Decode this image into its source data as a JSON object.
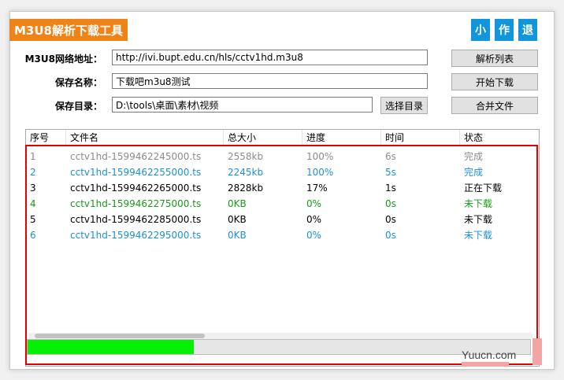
{
  "app": {
    "title": "M3U8解析下载工具"
  },
  "top_buttons": {
    "minimize": "小",
    "author": "作",
    "exit": "退"
  },
  "form": {
    "url_label": "M3U8网络地址：",
    "url_value": "http://ivi.bupt.edu.cn/hls/cctv1hd.m3u8",
    "name_label": "保存名称：",
    "name_value": "下载吧m3u8测试",
    "dir_label": "保存目录：",
    "dir_value": "D:\\tools\\桌面\\素材\\视频"
  },
  "buttons": {
    "parse": "解析列表",
    "start": "开始下载",
    "select_dir": "选择目录",
    "merge": "合并文件"
  },
  "table": {
    "columns": [
      "序号",
      "文件名",
      "总大小",
      "进度",
      "时间",
      "状态"
    ],
    "rows": [
      {
        "cells": [
          "1",
          "cctv1hd-1599462245000.ts",
          "2558kb",
          "100%",
          "6s",
          "完成"
        ],
        "color": "#8c8c8c"
      },
      {
        "cells": [
          "2",
          "cctv1hd-1599462255000.ts",
          "2245kb",
          "100%",
          "5s",
          "完成"
        ],
        "color": "#1e90d8"
      },
      {
        "cells": [
          "3",
          "cctv1hd-1599462265000.ts",
          "2828kb",
          "17%",
          "1s",
          "正在下载"
        ],
        "color": "#000000"
      },
      {
        "cells": [
          "4",
          "cctv1hd-1599462275000.ts",
          "0KB",
          "0%",
          "0s",
          "未下载"
        ],
        "color": "#1a9a1a"
      },
      {
        "cells": [
          "5",
          "cctv1hd-1599462285000.ts",
          "0KB",
          "0%",
          "0s",
          "未下载"
        ],
        "color": "#000000"
      },
      {
        "cells": [
          "6",
          "cctv1hd-1599462295000.ts",
          "0KB",
          "0%",
          "0s",
          "未下载"
        ],
        "color": "#1e90d8"
      }
    ]
  },
  "progress": {
    "fraction": 0.33
  },
  "watermark": {
    "text": "Yuucn.com"
  },
  "colors": {
    "accent": "#f08317",
    "button_blue": "#1296db",
    "progress_green": "#06f006",
    "highlight_red": "#e30000"
  }
}
